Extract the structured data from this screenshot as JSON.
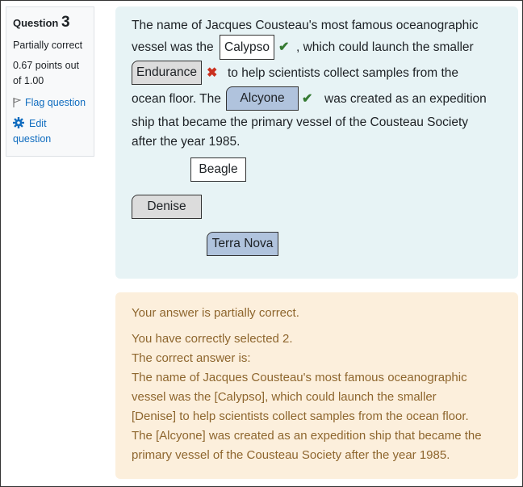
{
  "info": {
    "question_label": "Question",
    "question_number": "3",
    "state": "Partially correct",
    "grade": "0.67 points out of 1.00",
    "flag_label": "Flag question",
    "edit_label": "Edit question"
  },
  "question": {
    "line1": "The name of Jacques Cousteau's most famous oceanographic",
    "line2_before": "vessel was the",
    "line2_after": ", which could launch the smaller",
    "line3_after": "to help scientists collect samples from the",
    "line4_before": "ocean floor. The",
    "line4_after": "was created as an expedition",
    "line5": "ship that became the primary vessel of the Cousteau Society",
    "line6": "after the year 1985.",
    "drop1": "Calypso",
    "drop2": "Endurance",
    "drop3": "Alcyone",
    "choices": [
      "Beagle",
      "Denise",
      "Terra Nova"
    ]
  },
  "feedback": {
    "summary": "Your answer is partially correct.",
    "selected": "You have correctly selected 2.",
    "correct_intro": "The correct answer is:",
    "lines": [
      "The name of Jacques Cousteau's most famous oceanographic",
      "vessel was the [Calypso], which could launch the smaller",
      "[Denise] to help scientists collect samples from the ocean floor.",
      "The [Alcyone] was created as an expedition ship that became the",
      "primary vessel of the Cousteau Society after the year 1985."
    ]
  },
  "colors": {
    "correct": "#357a32",
    "incorrect": "#ca3120",
    "feedback_bg": "#fcefdc",
    "question_bg": "#e7f3f5"
  }
}
